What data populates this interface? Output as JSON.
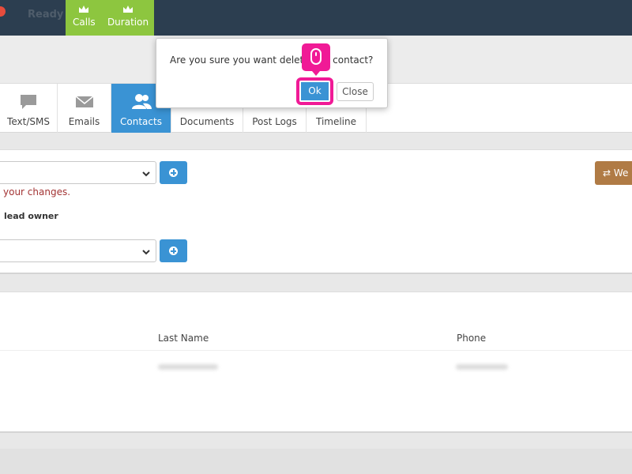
{
  "topbar": {
    "status": "Ready",
    "tabs": [
      {
        "label": "Calls",
        "icon": "crown-icon"
      },
      {
        "label": "Duration",
        "icon": "crown-icon"
      }
    ]
  },
  "tabs": [
    {
      "label": "Text/SMS",
      "icon": "speech-bubble-icon"
    },
    {
      "label": "Emails",
      "icon": "envelope-icon"
    },
    {
      "label": "Contacts",
      "icon": "users-icon",
      "active": true
    },
    {
      "label": "Documents",
      "icon": "document-icon"
    },
    {
      "label": "Post Logs",
      "icon": "log-icon"
    },
    {
      "label": "Timeline",
      "icon": "timeline-icon"
    }
  ],
  "panel1": {
    "warning": "your changes.",
    "owner_label": "lead owner",
    "web_button": "⇄ We"
  },
  "contacts_table": {
    "columns": [
      "Last Name",
      "Phone"
    ]
  },
  "dialog": {
    "message": "Are you sure you want delete this contact?",
    "ok_label": "Ok",
    "close_label": "Close"
  },
  "colors": {
    "accent": "#3a93d4",
    "topbar": "#2c3e50",
    "green": "#8dc63f",
    "highlight": "#f01a96"
  }
}
